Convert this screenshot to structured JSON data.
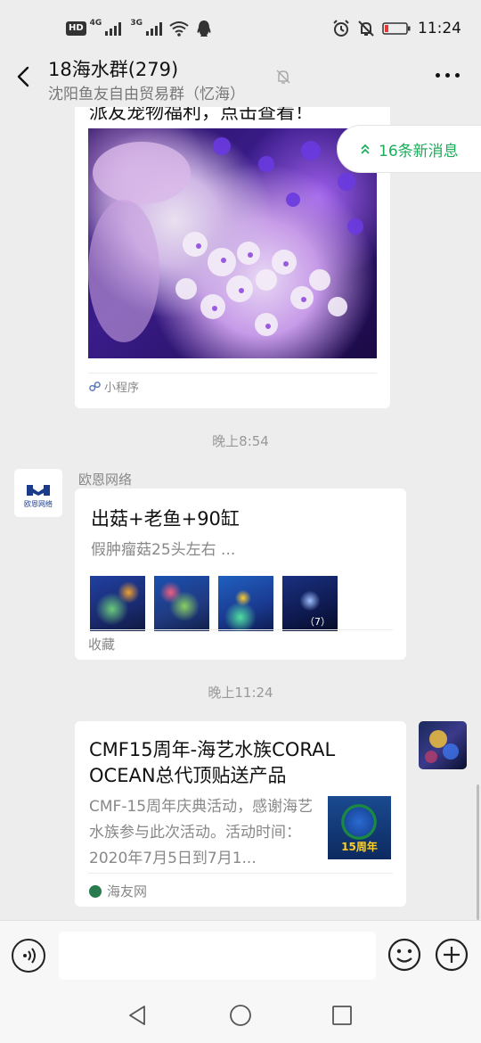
{
  "status_bar": {
    "hd_label": "HD",
    "net1": "4G",
    "net2": "3G",
    "time": "11:24",
    "icons": [
      "hd-icon",
      "signal-icon",
      "signal-icon",
      "wifi-icon",
      "qq-icon",
      "alarm-icon",
      "notifications-off-icon",
      "battery-icon"
    ]
  },
  "header": {
    "title": "18海水群(279)",
    "subtitle": "沈阳鱼友自由贸易群（忆海）",
    "icons": [
      "back-icon",
      "mute-icon",
      "more-icon"
    ]
  },
  "new_messages": {
    "label": "16条新消息"
  },
  "messages": {
    "mini_program": {
      "title": "派友宠物福利，点击查看！",
      "source": "小程序"
    },
    "time1": "晚上8:54",
    "favorite": {
      "sender": "欧恩网络",
      "avatar_text": "欧恩网络",
      "title": "出菇+老鱼+90缸",
      "desc": "假肿瘤菇25头左右 ...",
      "image_count": "（7）",
      "footer": "收藏"
    },
    "time2": "晚上11:24",
    "link": {
      "title": "CMF15周年-海艺水族CORAL OCEAN总代顶贴送产品",
      "desc": "CMF-15周年庆典活动，感谢海艺水族参与此次活动。活动时间：2020年7月5日到7月1...",
      "thumb_text": "15周年",
      "source": "海友网"
    }
  },
  "input_bar": {
    "placeholder": "",
    "icons": [
      "voice-icon",
      "emoji-icon",
      "plus-icon"
    ]
  },
  "nav_bar": {
    "icons": [
      "nav-back-icon",
      "nav-home-icon",
      "nav-recent-icon"
    ]
  },
  "colors": {
    "background": "#ededed",
    "accent_green": "#1aad5a",
    "card": "#ffffff"
  }
}
